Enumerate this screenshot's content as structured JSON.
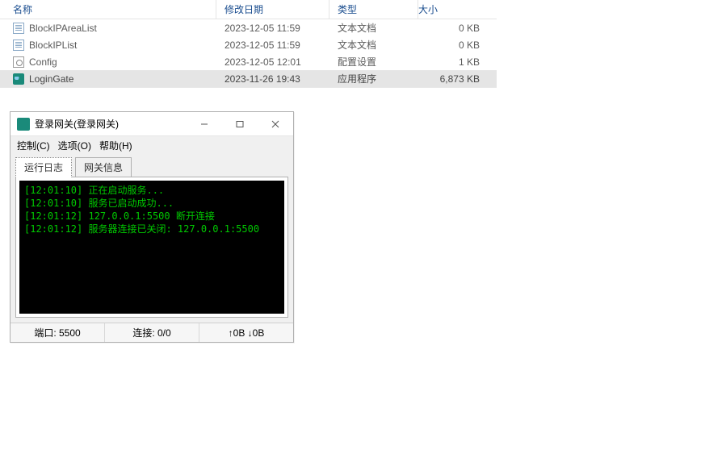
{
  "explorer": {
    "headers": {
      "name": "名称",
      "date": "修改日期",
      "type": "类型",
      "size": "大小"
    },
    "rows": [
      {
        "icon": "doc",
        "name": "BlockIPAreaList",
        "date": "2023-12-05 11:59",
        "type": "文本文档",
        "size": "0 KB",
        "selected": false
      },
      {
        "icon": "doc",
        "name": "BlockIPList",
        "date": "2023-12-05 11:59",
        "type": "文本文档",
        "size": "0 KB",
        "selected": false
      },
      {
        "icon": "cfg",
        "name": "Config",
        "date": "2023-12-05 12:01",
        "type": "配置设置",
        "size": "1 KB",
        "selected": false
      },
      {
        "icon": "app",
        "name": "LoginGate",
        "date": "2023-11-26 19:43",
        "type": "应用程序",
        "size": "6,873 KB",
        "selected": true
      }
    ]
  },
  "window": {
    "title": "登录网关(登录网关)",
    "menu": {
      "control": "控制(C)",
      "options": "选项(O)",
      "help": "帮助(H)"
    },
    "tabs": {
      "log": "运行日志",
      "info": "网关信息"
    },
    "log_lines": [
      {
        "ts": "[12:01:10]",
        "msg": "正在启动服务..."
      },
      {
        "ts": "[12:01:10]",
        "msg": "服务已启动成功..."
      },
      {
        "ts": "[12:01:12]",
        "msg": "127.0.0.1:5500 断开连接"
      },
      {
        "ts": "[12:01:12]",
        "msg": "服务器连接已关闭: 127.0.0.1:5500"
      }
    ],
    "status": {
      "port": "端口: 5500",
      "conn": "连接: 0/0",
      "up": "0B",
      "down": "0B"
    }
  }
}
